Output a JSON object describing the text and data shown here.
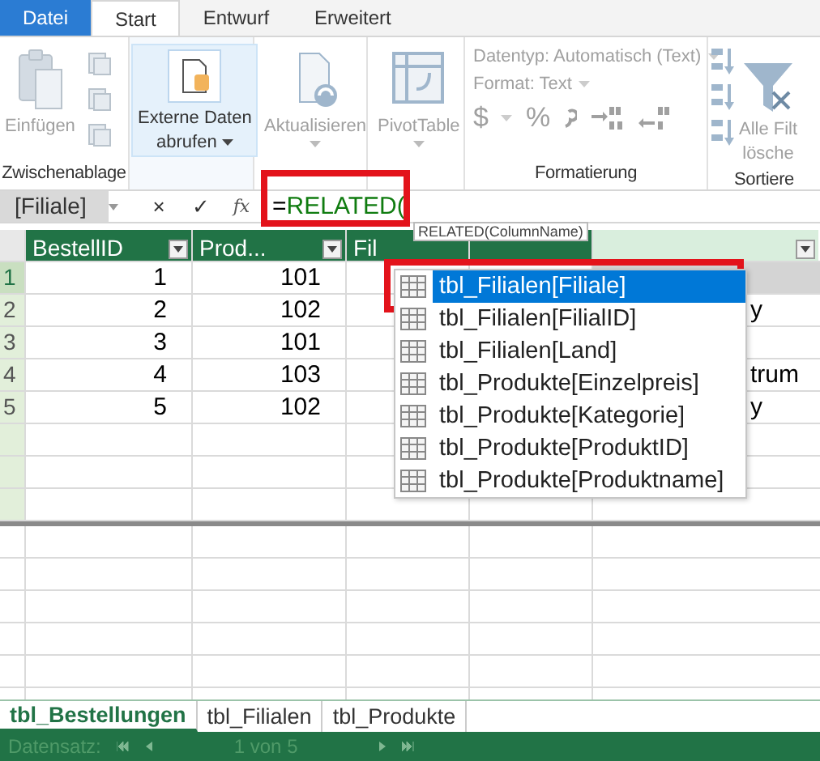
{
  "ribbon_tabs": [
    {
      "label": "Datei",
      "kind": "file",
      "selected": false
    },
    {
      "label": "Start",
      "kind": "tab",
      "selected": true
    },
    {
      "label": "Entwurf",
      "kind": "tab",
      "selected": false
    },
    {
      "label": "Erweitert",
      "kind": "tab",
      "selected": false
    }
  ],
  "ribbon_groups": [
    {
      "kind": "clipboard",
      "label": "Zwischenablage",
      "button": {
        "label": "Einfügen",
        "disabled": true
      }
    },
    {
      "kind": "external",
      "button": {
        "lines": [
          "Externe Daten",
          "abrufen"
        ],
        "highlighted": true,
        "disabled": false
      }
    },
    {
      "kind": "refresh",
      "button": {
        "lines": [
          "Aktualisieren"
        ],
        "disabled": true
      }
    },
    {
      "kind": "pivot",
      "button": {
        "lines": [
          "PivotTable"
        ],
        "disabled": true
      }
    },
    {
      "kind": "format",
      "label": "Formatierung",
      "fields": [
        "Datentyp: Automatisch (Text)",
        "Format: Text"
      ],
      "symbols": [
        "$",
        "%"
      ],
      "disabled": true
    },
    {
      "kind": "sort",
      "label": "Sortiere",
      "button": {
        "lines": [
          "Alle Filt",
          "lösche"
        ],
        "disabled": true
      }
    }
  ],
  "formula_bar": {
    "name_box": "[Filiale]",
    "cancel": "×",
    "confirm": "✓",
    "fx": "fx",
    "operator": "=",
    "function": "RELATED(",
    "tooltip": "RELATED(ColumnName)"
  },
  "table": {
    "columns": [
      {
        "label": "BestellID",
        "active": false,
        "filter": true
      },
      {
        "label": "Prod...",
        "active": false,
        "filter": true
      },
      {
        "label": "Fil",
        "active": false,
        "filter": false
      },
      {
        "active": false,
        "filter": false
      },
      {
        "active": true,
        "filter": true
      }
    ],
    "rows": [
      {
        "number": "1",
        "selected": true,
        "cells": [
          "1",
          "101",
          "",
          "",
          ""
        ]
      },
      {
        "number": "2",
        "selected": false,
        "cells": [
          "2",
          "102",
          "",
          "",
          "y"
        ]
      },
      {
        "number": "3",
        "selected": false,
        "cells": [
          "3",
          "101",
          "",
          "",
          ""
        ]
      },
      {
        "number": "4",
        "selected": false,
        "cells": [
          "4",
          "103",
          "",
          "",
          "trum"
        ]
      },
      {
        "number": "5",
        "selected": false,
        "cells": [
          "5",
          "102",
          "",
          "",
          "y"
        ]
      }
    ]
  },
  "autocomplete": [
    {
      "label": "tbl_Filialen[Filiale]",
      "selected": true
    },
    {
      "label": "tbl_Filialen[FilialID]",
      "selected": false
    },
    {
      "label": "tbl_Filialen[Land]",
      "selected": false
    },
    {
      "label": "tbl_Produkte[Einzelpreis]",
      "selected": false
    },
    {
      "label": "tbl_Produkte[Kategorie]",
      "selected": false
    },
    {
      "label": "tbl_Produkte[ProduktID]",
      "selected": false
    },
    {
      "label": "tbl_Produkte[Produktname]",
      "selected": false
    }
  ],
  "sheet_tabs": [
    {
      "label": "tbl_Bestellungen",
      "selected": true
    },
    {
      "label": "tbl_Filialen",
      "selected": false
    },
    {
      "label": "tbl_Produkte",
      "selected": false
    }
  ],
  "status_bar": {
    "record_label": "Datensatz:",
    "position": "1 von 5"
  }
}
